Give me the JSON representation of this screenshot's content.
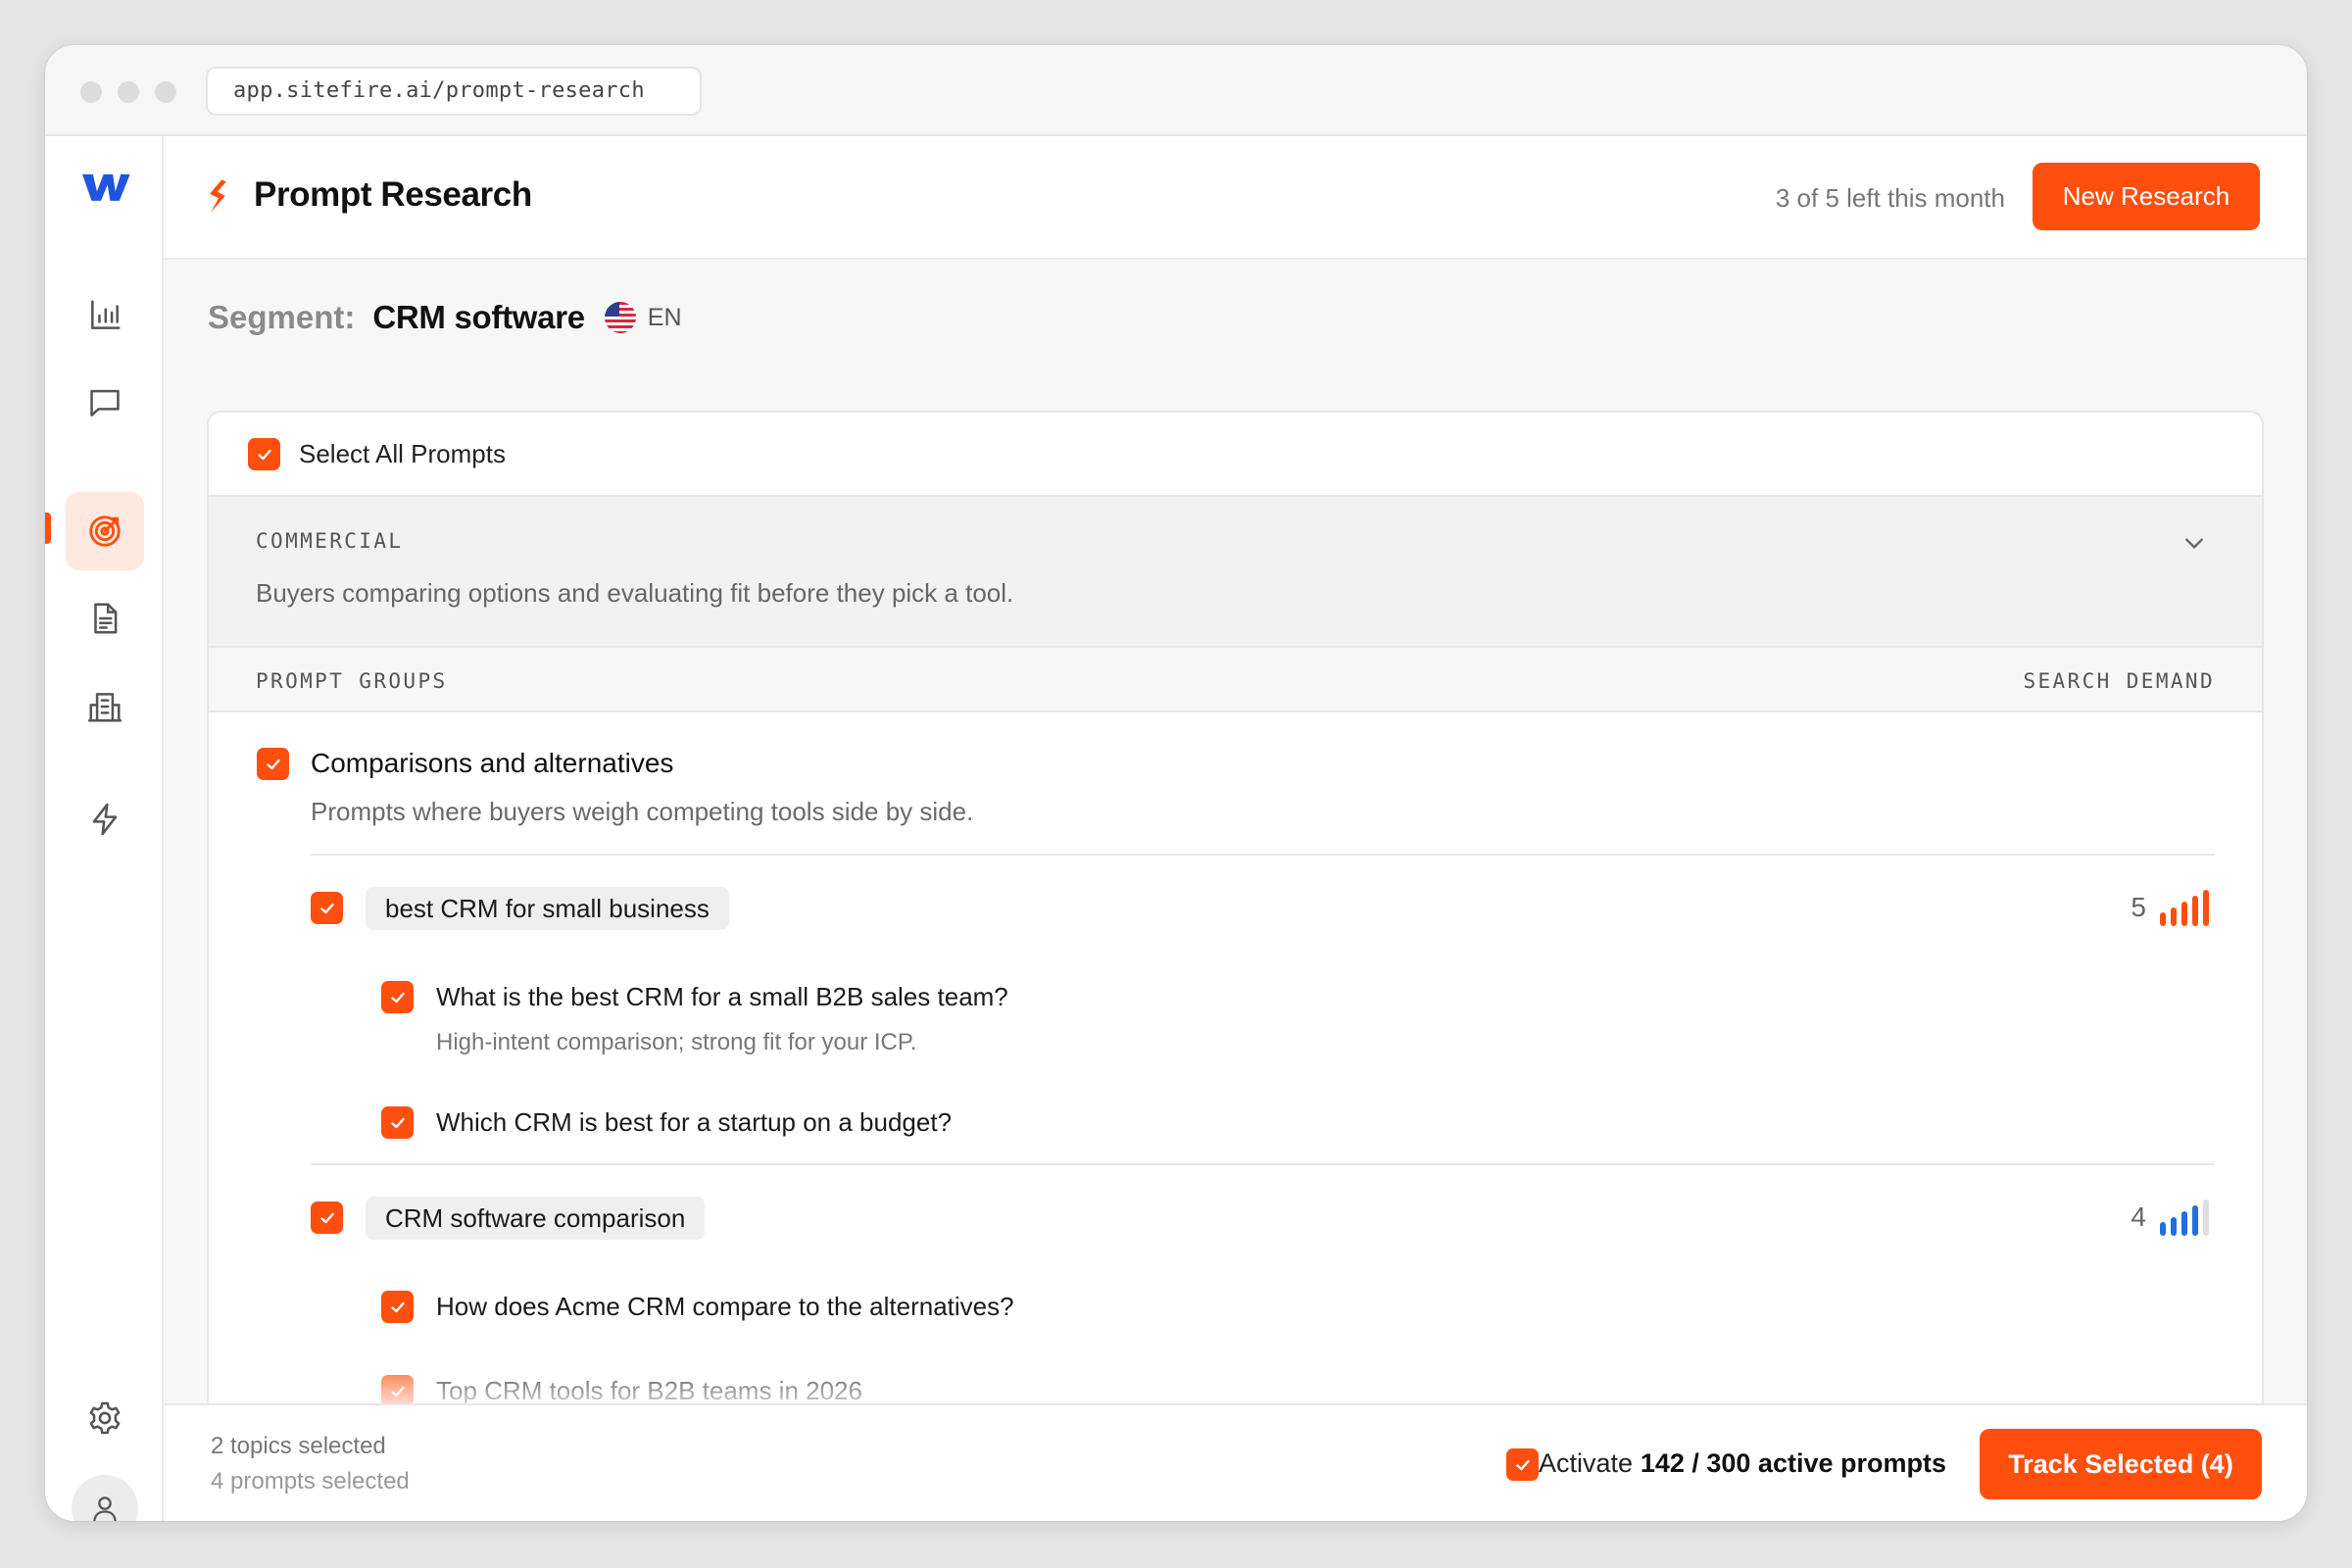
{
  "browser": {
    "url": "app.sitefire.ai/prompt-research"
  },
  "sidebar": {
    "items": [
      {
        "icon": "bar-chart-icon"
      },
      {
        "icon": "chat-icon"
      },
      {
        "icon": "target-icon",
        "active": true
      },
      {
        "icon": "document-icon"
      },
      {
        "icon": "building-icon"
      },
      {
        "icon": "lightning-icon"
      }
    ],
    "bottom": [
      {
        "icon": "gear-icon"
      },
      {
        "icon": "user-icon"
      }
    ]
  },
  "header": {
    "title": "Prompt Research",
    "quota": "3 of 5 left this month",
    "new_button": "New Research"
  },
  "segment": {
    "label": "Segment:",
    "value": "CRM software",
    "language": "EN"
  },
  "select_all": {
    "label": "Select All Prompts",
    "checked": true
  },
  "category": {
    "title": "COMMERCIAL",
    "description": "Buyers comparing options and evaluating fit before they pick a tool."
  },
  "columns": {
    "left": "PROMPT GROUPS",
    "right": "SEARCH DEMAND"
  },
  "group": {
    "title": "Comparisons and alternatives",
    "description": "Prompts where buyers weigh competing tools side by side.",
    "checked": true,
    "topics": [
      {
        "label": "best CRM for small business",
        "demand": "5",
        "demand_level": 5,
        "bar_color": "#ff4f0f",
        "checked": true,
        "prompts": [
          {
            "text": "What is the best CRM for a small B2B sales team?",
            "note": "High-intent comparison; strong fit for your ICP.",
            "checked": true
          },
          {
            "text": "Which CRM is best for a startup on a budget?",
            "checked": true
          }
        ]
      },
      {
        "label": "CRM software comparison",
        "demand": "4",
        "demand_level": 4,
        "bar_color": "#1f6fe5",
        "checked": true,
        "prompts": [
          {
            "text": "How does Acme CRM compare to the alternatives?",
            "checked": true
          },
          {
            "text": "Top CRM tools for B2B teams in 2026",
            "checked": true
          }
        ]
      }
    ]
  },
  "footer": {
    "topics_selected": "2 topics selected",
    "prompts_selected": "4 prompts selected",
    "activate_label": "Activate",
    "active_prompts": "142 / 300 active prompts",
    "track_button": "Track Selected (4)"
  },
  "colors": {
    "accent": "#ff4f0f",
    "blue": "#1f6fe5"
  }
}
